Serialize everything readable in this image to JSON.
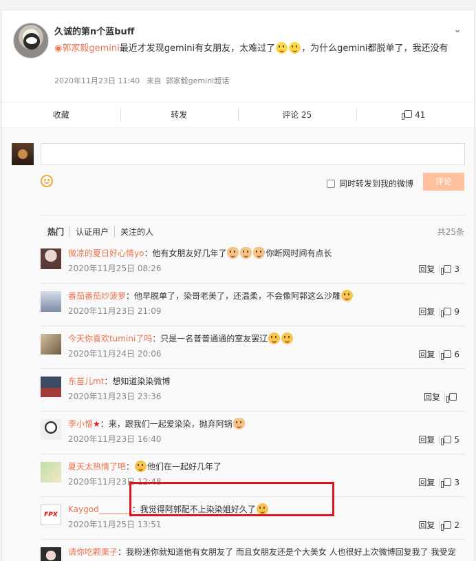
{
  "post": {
    "author": "久诚的第n个蓝buff",
    "topic_link": "郭家毅gemini",
    "text": "最近才发现gemini有女朋友，太难过了",
    "text_tail": "，为什么gemini都脱单了，我还没有",
    "timestamp": "2020年11月23日 11:40",
    "source_prefix": "来自",
    "source": "郭家毅gemini超话"
  },
  "actions": {
    "favorite": "收藏",
    "forward": "转发",
    "comment": "评论 25",
    "like_count": "41"
  },
  "composer": {
    "forward_checkbox_label": "同时转发到我的微博",
    "submit_label": "评论"
  },
  "filters": {
    "hot": "热门",
    "verified": "认证用户",
    "following": "关注的人",
    "total": "共25条"
  },
  "comments": [
    {
      "user": "微凉的夏日好心情yo",
      "sep": "：",
      "pre": "他有女朋友好几年了",
      "post": "你断网时间有点长",
      "time": "2020年11月25日 08:26",
      "reply": "回复",
      "likes": "3"
    },
    {
      "user": "番茄番茄炒菠萝",
      "sep": "：",
      "pre": "他早脱单了，染哥老美了，还温柔，不会像阿郭这么沙雕",
      "post": "",
      "time": "2020年11月23日 21:09",
      "reply": "回复",
      "likes": "9"
    },
    {
      "user": "今天你喜欢tumini了吗",
      "sep": "：",
      "pre": "只是一名普普通通的室友罢辽",
      "post": "",
      "time": "2020年11月24日 20:06",
      "reply": "回复",
      "likes": "6"
    },
    {
      "user": "东苗儿mt",
      "sep": "：",
      "pre": "想知道染染微博",
      "post": "",
      "time": "2020年11月23日 23:36",
      "reply": "回复",
      "likes": ""
    },
    {
      "user": "李小憎",
      "sep": "：",
      "pre": "来，跟我们一起爱染染，抛弃阿锅",
      "post": "",
      "time": "2020年11月23日 16:40",
      "reply": "回复",
      "likes": "5"
    },
    {
      "user": "夏天太热情了吧",
      "sep": "：",
      "pre": "",
      "post": "他们在一起好几年了",
      "time": "2020年11月23日 12:48",
      "reply": "回复",
      "likes": "3"
    },
    {
      "user": "Kaygod________",
      "sep": "：",
      "pre": "我觉得阿郭配不上染染姐好久了",
      "post": "",
      "time": "2020年11月25日 13:51",
      "reply": "回复",
      "likes": "2"
    },
    {
      "user": "请你吃颗栗子",
      "sep": "：",
      "pre": "我粉迷你就知道他有女朋友了 而且女朋友还是个大美女 人也很好上次微博回复我了 我受宠若惊",
      "post": "",
      "time": "",
      "reply": "",
      "likes": ""
    }
  ]
}
